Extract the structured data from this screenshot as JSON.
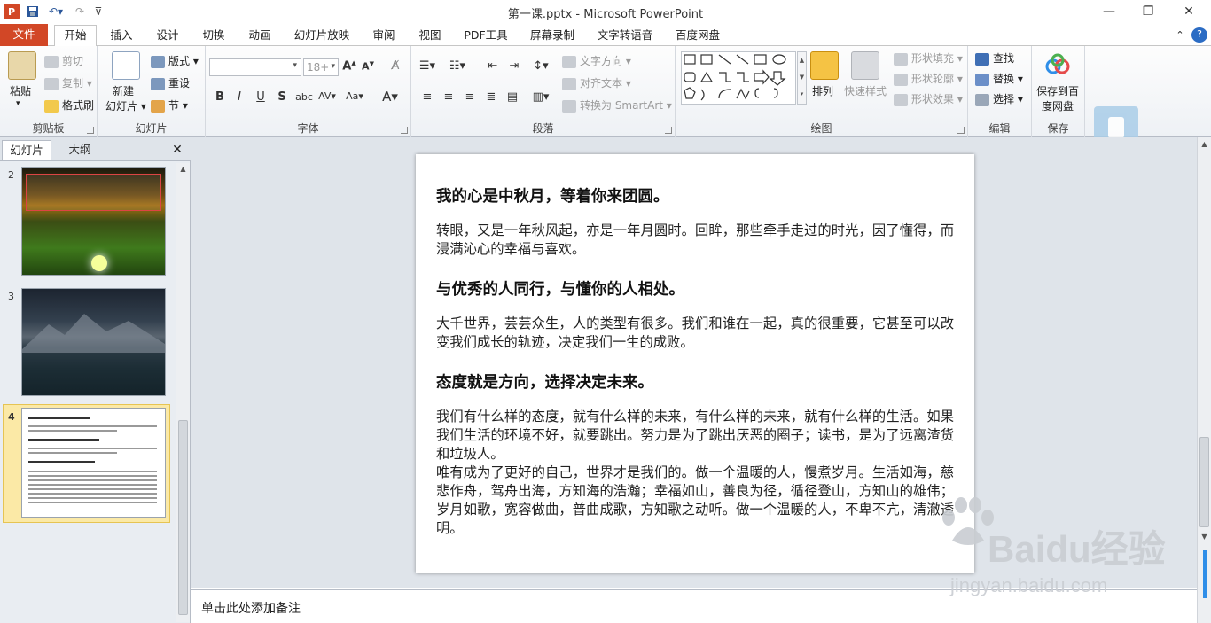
{
  "window": {
    "title": "第一课.pptx - Microsoft PowerPoint"
  },
  "tabs": [
    "文件",
    "开始",
    "插入",
    "设计",
    "切换",
    "动画",
    "幻灯片放映",
    "审阅",
    "视图",
    "PDF工具",
    "屏幕录制",
    "文字转语音",
    "百度网盘"
  ],
  "ribbon": {
    "clipboard": {
      "paste": "粘贴",
      "cut": "剪切",
      "copy": "复制",
      "format_painter": "格式刷",
      "label": "剪贴板"
    },
    "slides": {
      "new_slide": "新建",
      "new_slide2": "幻灯片",
      "layout": "版式",
      "reset": "重设",
      "section": "节",
      "label": "幻灯片"
    },
    "font": {
      "size": "18+",
      "label": "字体"
    },
    "paragraph": {
      "text_direction": "文字方向",
      "align_text": "对齐文本",
      "smartart": "转换为 SmartArt",
      "label": "段落"
    },
    "drawing": {
      "arrange": "排列",
      "quick_styles": "快速样式",
      "shape_fill": "形状填充",
      "shape_outline": "形状轮廓",
      "shape_effects": "形状效果",
      "label": "绘图"
    },
    "editing": {
      "find": "查找",
      "replace": "替换",
      "select": "选择",
      "label": "编辑"
    },
    "save": {
      "save_baidu": "保存到百",
      "save_baidu2": "度网盘",
      "label": "保存"
    }
  },
  "left_pane": {
    "tabs": [
      "幻灯片",
      "大纲"
    ],
    "slides": [
      {
        "number": "2"
      },
      {
        "number": "3"
      },
      {
        "number": "4"
      }
    ]
  },
  "slide": {
    "heading1": "我的心是中秋月，等着你来团圆。",
    "para1": "转眼，又是一年秋风起，亦是一年月圆时。回眸，那些牵手走过的时光，因了懂得，而浸满沁心的幸福与喜欢。",
    "heading2": "与优秀的人同行，与懂你的人相处。",
    "para2": "大千世界，芸芸众生，人的类型有很多。我们和谁在一起，真的很重要，它甚至可以改变我们成长的轨迹，决定我们一生的成败。",
    "heading3": "态度就是方向，选择决定未来。",
    "para3": "我们有什么样的态度，就有什么样的未来，有什么样的未来，就有什么样的生活。如果我们生活的环境不好，就要跳出。努力是为了跳出厌恶的圈子；读书，是为了远离渣货和垃圾人。",
    "para4": "唯有成为了更好的自己，世界才是我们的。做一个温暖的人，慢煮岁月。生活如海，慈悲作舟，驾舟出海，方知海的浩瀚；幸福如山，善良为径，循径登山，方知山的雄伟；岁月如歌，宽容做曲，普曲成歌，方知歌之动听。做一个温暖的人，不卑不亢，清澈透明。"
  },
  "notes": {
    "placeholder": "单击此处添加备注"
  },
  "watermark": {
    "brand": "Baidu经验",
    "url": "jingyan.baidu.com"
  }
}
